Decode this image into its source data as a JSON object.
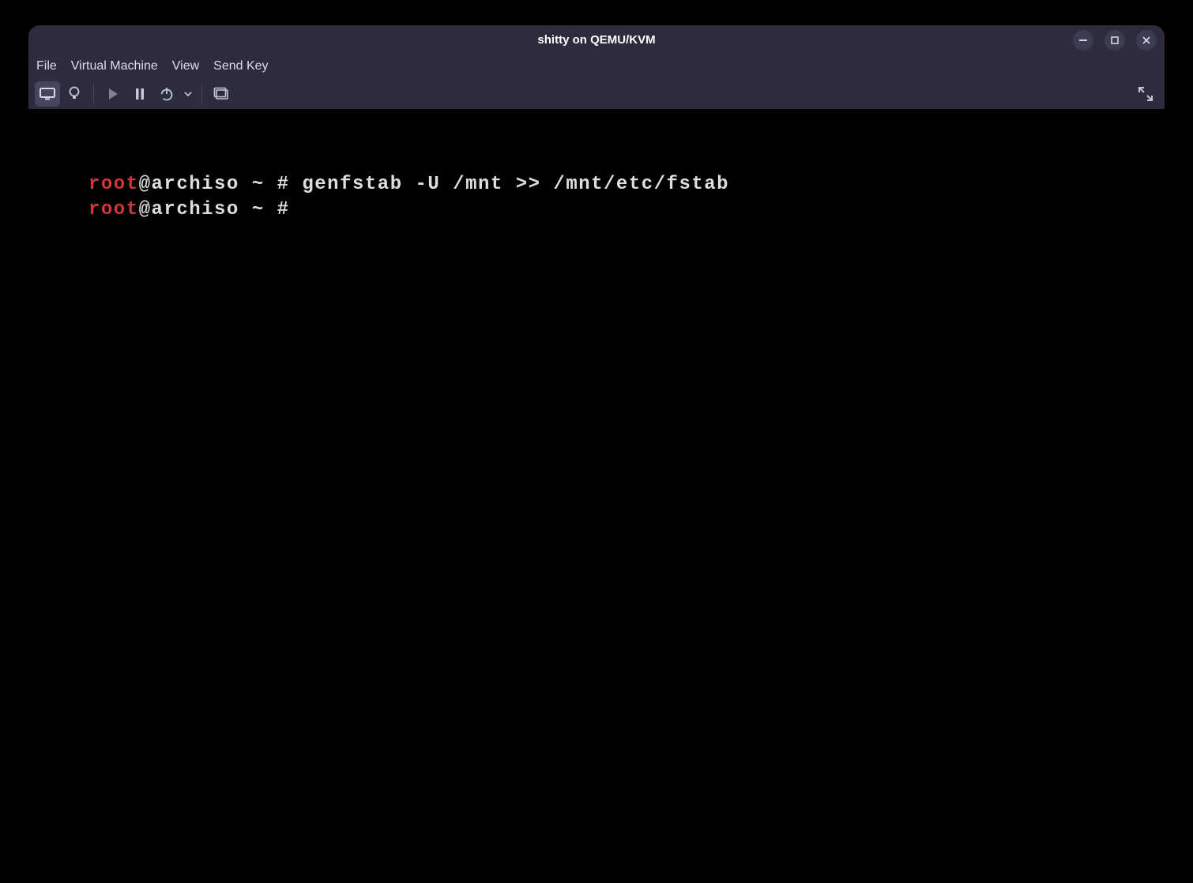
{
  "title": "shitty on QEMU/KVM",
  "menu": {
    "file": "File",
    "vm": "Virtual Machine",
    "view": "View",
    "sendkey": "Send Key"
  },
  "toolbar_icons": {
    "monitor": "monitor-icon",
    "bulb": "bulb-icon",
    "play": "play-icon",
    "pause": "pause-icon",
    "power": "power-icon",
    "dropdown": "chevron-down-icon",
    "screenshot": "screenshot-icon",
    "fullscreen": "fullscreen-icon"
  },
  "window_controls": {
    "min": "–",
    "max": "❐",
    "close": "✕"
  },
  "terminal": {
    "lines": [
      {
        "user": "root",
        "at": "@",
        "host": "archiso",
        "cwd": " ~ ",
        "hash": "# ",
        "cmd": "genfstab -U /mnt >> /mnt/etc/fstab"
      },
      {
        "user": "root",
        "at": "@",
        "host": "archiso",
        "cwd": " ~ ",
        "hash": "# ",
        "cmd": ""
      }
    ]
  }
}
